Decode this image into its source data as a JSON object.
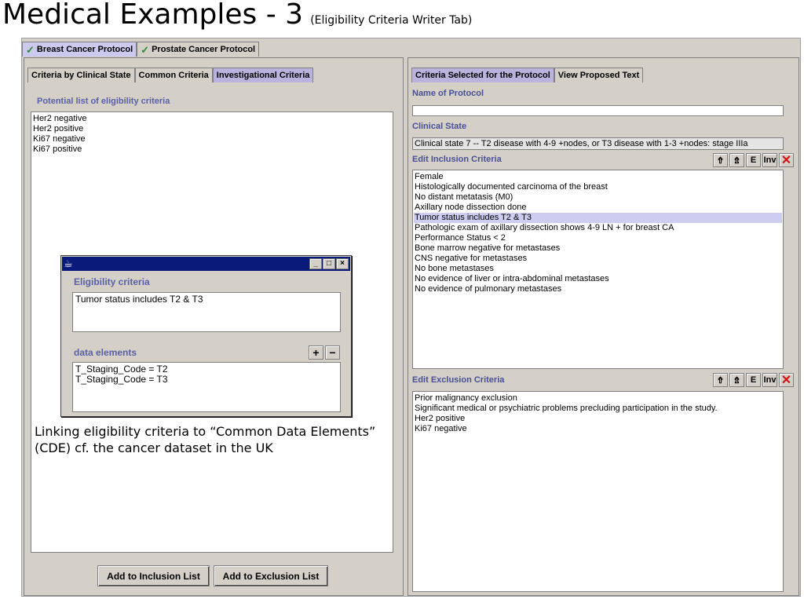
{
  "slide": {
    "title": "Medical Examples - 3",
    "subtitle": "(Eligibility Criteria Writer Tab)"
  },
  "top_tabs": [
    {
      "label": "Breast Cancer Protocol",
      "icon": "check-icon",
      "selected": true
    },
    {
      "label": "Prostate Cancer Protocol",
      "icon": "check-icon",
      "selected": false
    }
  ],
  "left_panel": {
    "tabs": [
      "Criteria by Clinical State",
      "Common Criteria",
      "Investigational Criteria"
    ],
    "selected_tab": "Investigational Criteria",
    "list_label": "Potential list of eligibility criteria",
    "items": [
      "Her2 negative",
      "Her2 positive",
      "Ki67 negative",
      "Ki67 positive"
    ],
    "buttons": {
      "add_inclusion": "Add to Inclusion List",
      "add_exclusion": "Add to Exclusion List"
    }
  },
  "popup": {
    "eligibility_label": "Eligibility criteria",
    "eligibility_value": "Tumor status includes T2 & T3",
    "data_elements_label": "data elements",
    "data_elements": [
      "T_Staging_Code = T2",
      "T_Staging_Code = T3"
    ],
    "plus": "+",
    "minus": "−",
    "win_min": "_",
    "win_max": "□",
    "win_close": "×"
  },
  "annotation": "Linking eligibility criteria to “Common Data Elements” (CDE) cf. the cancer dataset in the UK",
  "right_panel": {
    "tabs": [
      "Criteria Selected for the Protocol",
      "View Proposed Text"
    ],
    "selected_tab": "Criteria Selected for the Protocol",
    "name_label": "Name of Protocol",
    "name_value": "",
    "clinical_state_label": "Clinical State",
    "clinical_state_value": "Clinical state 7 -- T2 disease with 4-9 +nodes, or T3 disease with 1-3 +nodes: stage IIIa",
    "inclusion_label": "Edit Inclusion Criteria",
    "inclusion_items": [
      "Female",
      "Histologically documented carcinoma of the breast",
      "No distant metatasis (M0)",
      "Axillary node dissection done",
      "Tumor status includes T2 & T3",
      "Pathologic exam of axillary dissection shows 4-9 LN + for breast CA",
      "Performance Status < 2",
      "Bone marrow negative for metastases",
      "CNS negative for metastases",
      "No bone metastases",
      "No evidence of liver or intra-abdominal metastases",
      "No evidence of pulmonary metastases"
    ],
    "inclusion_highlighted": "Tumor status includes T2 & T3",
    "exclusion_label": "Edit Exclusion Criteria",
    "exclusion_items": [
      "Prior malignancy exclusion",
      "Significant medical or psychiatric problems precluding participation in the study.",
      "Her2 positive",
      "Ki67 negative"
    ],
    "toolbar": {
      "up": "⇮",
      "down": "⇯",
      "edit": "E",
      "inv": "Inv",
      "delete": "✕"
    }
  },
  "colors": {
    "accent_label": "#5a5fa6",
    "selected_tab": "#b9b3de",
    "highlight_row": "#cdcdf2",
    "titlebar": "#0a1a7a"
  }
}
